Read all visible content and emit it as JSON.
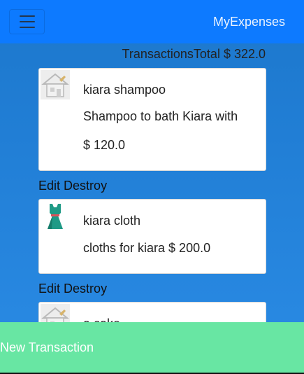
{
  "navbar": {
    "brand": "MyExpenses"
  },
  "summary": {
    "label": "Transactions",
    "total_label": "Total $ 322.0"
  },
  "transactions": [
    {
      "title": "kiara shampoo",
      "description": "Shampoo to bath Kiara with",
      "amount": "$ 120.0",
      "icon": "house-icon"
    },
    {
      "title": "kiara cloth",
      "description_amount": "cloths for kiara $ 200.0",
      "icon": "dress-icon"
    },
    {
      "title": "a cake",
      "icon": "house-icon"
    }
  ],
  "actions": {
    "edit_label": "Edit",
    "destroy_label": "Destroy"
  },
  "footer": {
    "new_label": "New Transaction"
  },
  "colors": {
    "navbar": "#0d7aff",
    "new_button": "#68e6a3",
    "background": "#1c77cc"
  }
}
